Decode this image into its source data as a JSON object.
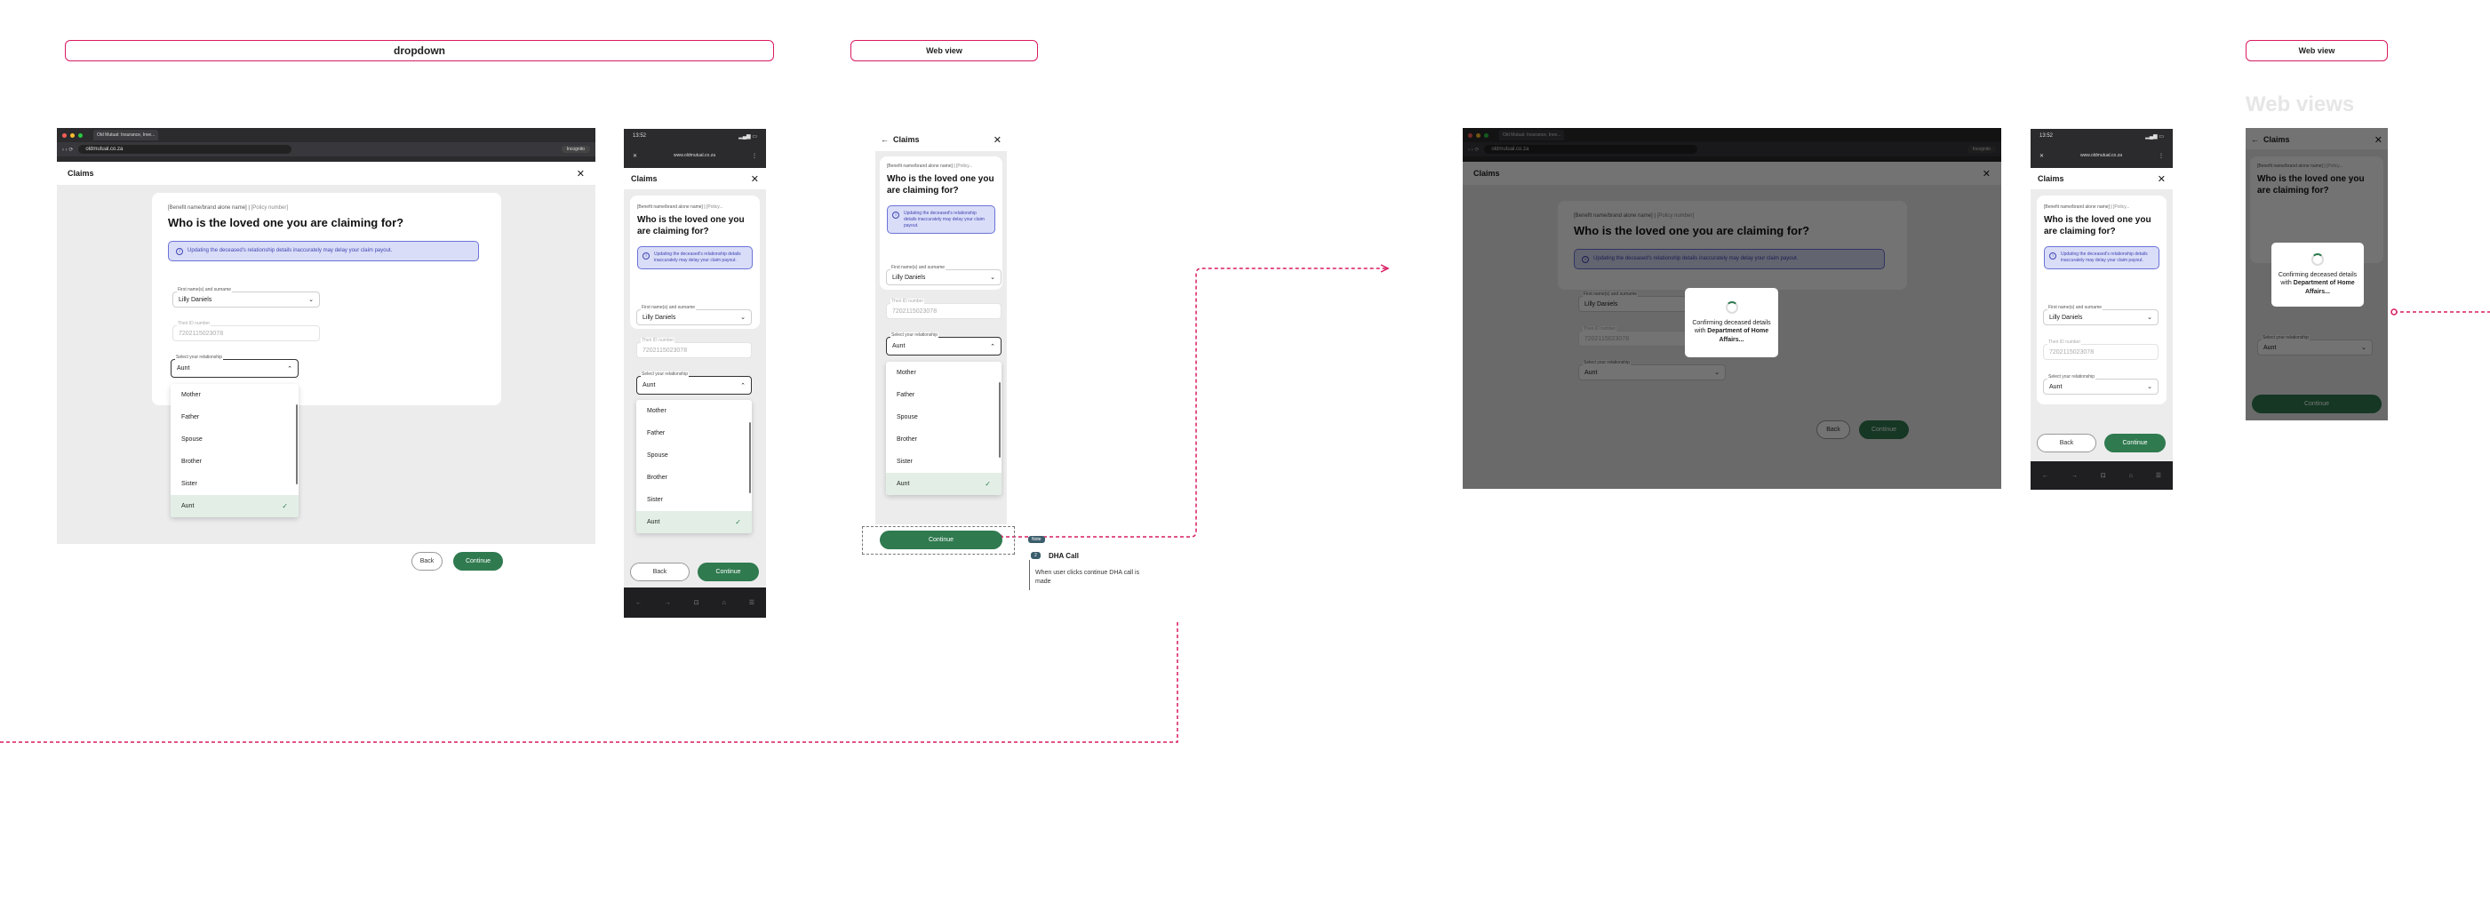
{
  "labels": {
    "dropdown": "dropdown",
    "web_view": "Web view",
    "web_view_2": "Web view",
    "web_views": "Web views"
  },
  "browser": {
    "tab_title": "Old Mutual: Insurance, Inve...",
    "url": "oldmutual.co.za",
    "incognito": "Incognito"
  },
  "phone": {
    "time": "13:52",
    "url": "www.oldmutual.co.za"
  },
  "app": {
    "title": "Claims"
  },
  "form": {
    "eyebrow": "[Benefit name/brand alone name]",
    "policy": "[Policy number]",
    "eyebrow_short": "[Policy...",
    "question": "Who is the loved one you are claiming for?",
    "warning": "Updating the deceased's relationship details inaccurately may delay your claim payout.",
    "name_label": "First name(s) and surname",
    "name_value": "Lilly Daniels",
    "id_label": "Their ID number",
    "id_value": "7202115023078",
    "rel_label": "Select your relationship",
    "rel_value": "Aunt",
    "options": [
      "Mother",
      "Father",
      "Spouse",
      "Brother",
      "Sister",
      "Aunt"
    ]
  },
  "buttons": {
    "back": "Back",
    "continue": "Continue"
  },
  "modal": {
    "line1": "Confirming deceased details with",
    "bold": "Department of Home Affairs..."
  },
  "note": {
    "pill": "Note",
    "badge": "2",
    "title": "DHA Call",
    "body": "When user clicks continue DHA call is made"
  },
  "colors": {
    "accent": "#2f7a4f",
    "flow": "#d81b60",
    "warning_bg": "#d9ddf8"
  }
}
